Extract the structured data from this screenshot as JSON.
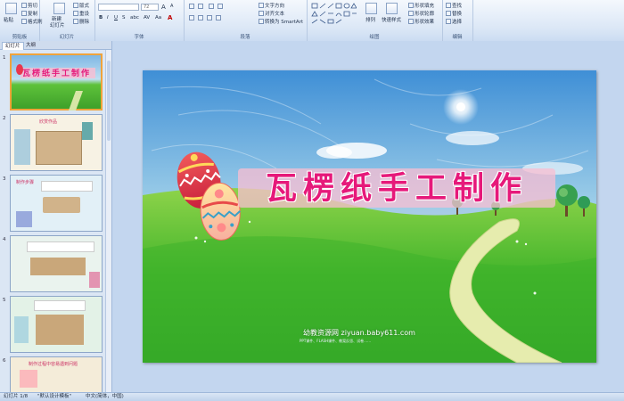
{
  "ribbon": {
    "clipboard": {
      "label": "剪贴板",
      "paste": "粘贴",
      "cut": "剪切",
      "copy": "复制",
      "format_painter": "格式刷"
    },
    "slides": {
      "label": "幻灯片",
      "new_slide": "新建",
      "new_slide2": "幻灯片",
      "layout": "版式",
      "reset": "重设",
      "delete": "删除"
    },
    "font": {
      "label": "字体",
      "size": "72",
      "bold": "B",
      "italic": "I",
      "underline": "U",
      "strike": "S",
      "shadow": "abc",
      "spacing": "AV",
      "case": "Aa",
      "color": "A",
      "grow": "A",
      "shrink": "A"
    },
    "paragraph": {
      "label": "段落",
      "text_direction": "文字方向",
      "align_text": "对齐文本",
      "smartart": "转换为 SmartArt"
    },
    "drawing": {
      "label": "绘图",
      "arrange": "排列",
      "quick_styles": "快速样式",
      "fill": "形状填充",
      "outline": "形状轮廓",
      "effects": "形状效果"
    },
    "editing": {
      "label": "编辑",
      "find": "查找",
      "replace": "替换",
      "select": "选择"
    }
  },
  "left_pane": {
    "tab_slides": "幻灯片",
    "tab_outline": "大纲",
    "thumbs": [
      {
        "num": "1",
        "title": "瓦楞纸手工制作"
      },
      {
        "num": "2",
        "title": "欣赏作品"
      },
      {
        "num": "3",
        "title": "制作步骤"
      },
      {
        "num": "4",
        "title": ""
      },
      {
        "num": "5",
        "title": ""
      },
      {
        "num": "6",
        "title": "制作过程中容易遇到问题"
      }
    ]
  },
  "slide": {
    "title": "瓦楞纸手工制作",
    "watermark": "幼教资源网 ziyuan.baby611.com",
    "watermark_sub": "PPT课件、FLASH课件、教案反思、试卷……"
  },
  "status": {
    "slide_index": "幻灯片 1/8",
    "theme": "\"默认设计模板\"",
    "language": "中文(简体，中国)"
  },
  "colors": {
    "title": "#e6197a",
    "accent": "#f0a33a"
  }
}
